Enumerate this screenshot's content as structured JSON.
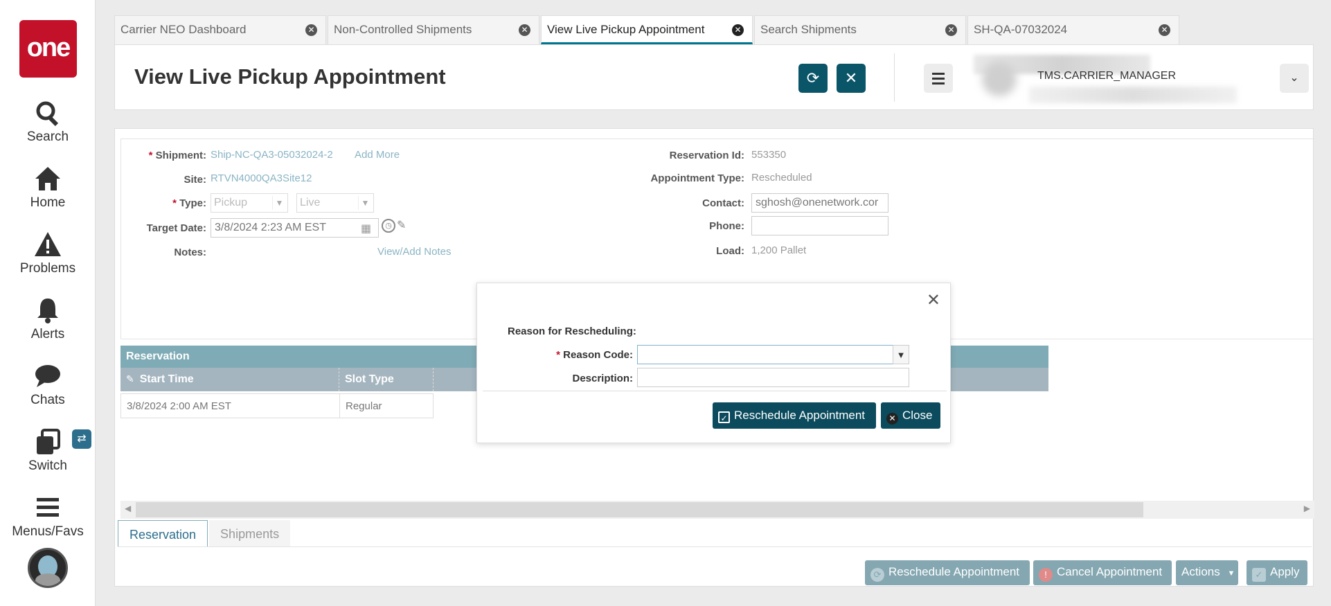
{
  "nav": {
    "logo_text": "one",
    "items": [
      {
        "label": "Search",
        "icon": "search-icon"
      },
      {
        "label": "Home",
        "icon": "home-icon"
      },
      {
        "label": "Problems",
        "icon": "warning-icon"
      },
      {
        "label": "Alerts",
        "icon": "bell-icon"
      },
      {
        "label": "Chats",
        "icon": "chat-icon"
      },
      {
        "label": "Switch",
        "icon": "switch-icon"
      },
      {
        "label": "Menus/Favs",
        "icon": "hamburger-icon"
      }
    ],
    "switch_badge": "⇄"
  },
  "tabs": [
    {
      "label": "Carrier NEO Dashboard",
      "active": false
    },
    {
      "label": "Non-Controlled Shipments",
      "active": false
    },
    {
      "label": "View Live Pickup Appointment",
      "active": true
    },
    {
      "label": "Search Shipments",
      "active": false
    },
    {
      "label": "SH-QA-07032024",
      "active": false
    }
  ],
  "header": {
    "title": "View Live Pickup Appointment",
    "user_role": "TMS.CARRIER_MANAGER"
  },
  "form": {
    "shipment_label": "Shipment:",
    "shipment_value": "Ship-NC-QA3-05032024-2",
    "add_more": "Add More",
    "site_label": "Site:",
    "site_value": "RTVN4000QA3Site12",
    "type_label": "Type:",
    "type_value": "Pickup",
    "subtype_value": "Live",
    "target_date_label": "Target Date:",
    "target_date_value": "3/8/2024 2:23 AM EST",
    "notes_label": "Notes:",
    "notes_link": "View/Add Notes",
    "reservation_id_label": "Reservation Id:",
    "reservation_id_value": "553350",
    "appointment_type_label": "Appointment Type:",
    "appointment_type_value": "Rescheduled",
    "contact_label": "Contact:",
    "contact_value": "sghosh@onenetwork.cor",
    "phone_label": "Phone:",
    "phone_value": "",
    "load_label": "Load:",
    "load_value": "1,200 Pallet"
  },
  "grid": {
    "title": "Reservation",
    "columns": [
      "Start Time",
      "Slot Type"
    ],
    "rows": [
      {
        "start_time": "3/8/2024 2:00 AM EST",
        "slot_type": "Regular"
      }
    ]
  },
  "bottom_tabs": [
    "Reservation",
    "Shipments"
  ],
  "actions": {
    "reschedule": "Reschedule Appointment",
    "cancel": "Cancel Appointment",
    "actions": "Actions",
    "apply": "Apply"
  },
  "modal": {
    "section": "Reason for Rescheduling:",
    "reason_code_label": "Reason Code:",
    "reason_code_value": "",
    "description_label": "Description:",
    "description_value": "",
    "reschedule_btn": "Reschedule Appointment",
    "close_btn": "Close"
  },
  "colors": {
    "brand_red": "#c3112a",
    "primary_teal": "#0b5569",
    "grid_header": "#7fabb6",
    "link": "#8ab4c4"
  }
}
